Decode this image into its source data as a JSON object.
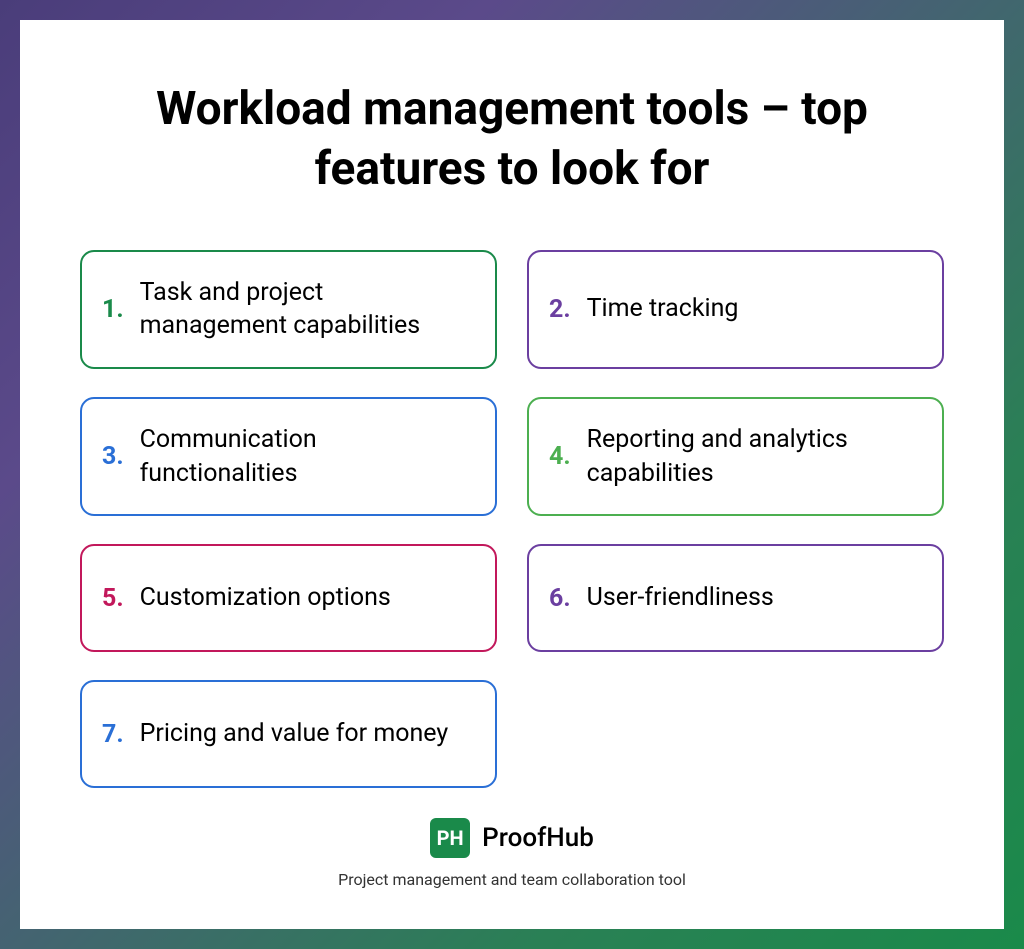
{
  "title": "Workload management tools – top features to look for",
  "features": [
    {
      "number": "1.",
      "text": "Task and project management capabilities",
      "border": "#1a8a4a",
      "numColor": "#1a8a4a"
    },
    {
      "number": "2.",
      "text": "Time tracking",
      "border": "#6b3fa0",
      "numColor": "#6b3fa0"
    },
    {
      "number": "3.",
      "text": "Communication functionalities",
      "border": "#2a6fd6",
      "numColor": "#2a6fd6"
    },
    {
      "number": "4.",
      "text": "Reporting and analytics capabilities",
      "border": "#4caf50",
      "numColor": "#4caf50"
    },
    {
      "number": "5.",
      "text": "Customization options",
      "border": "#c2185b",
      "numColor": "#c2185b"
    },
    {
      "number": "6.",
      "text": "User-friendliness",
      "border": "#6b3fa0",
      "numColor": "#6b3fa0"
    },
    {
      "number": "7.",
      "text": "Pricing and value for money",
      "border": "#2a6fd6",
      "numColor": "#2a6fd6"
    }
  ],
  "logo": {
    "iconText": "PH",
    "name": "ProofHub"
  },
  "tagline": "Project management and team collaboration tool"
}
